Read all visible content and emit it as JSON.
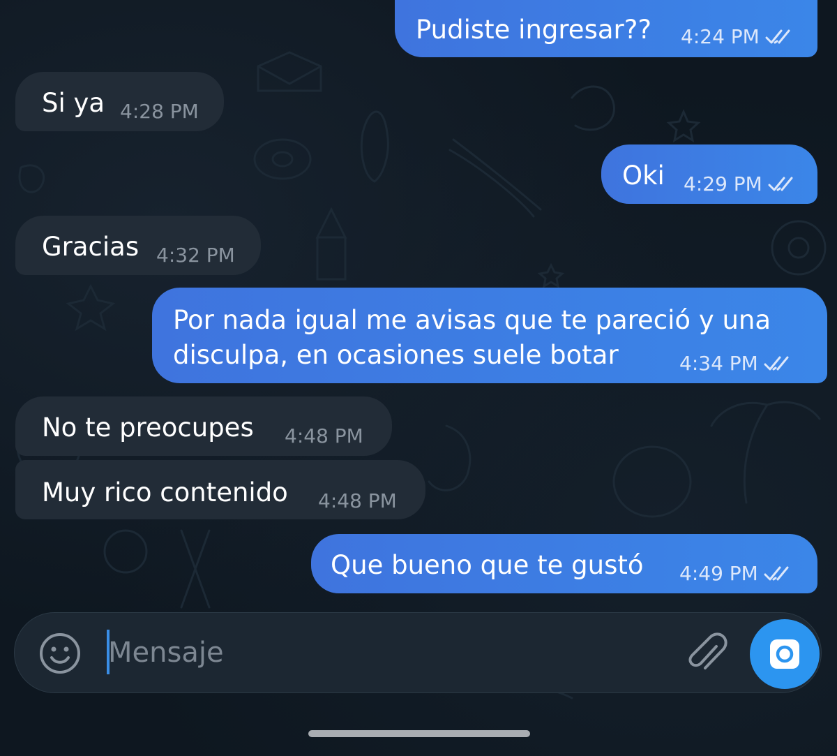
{
  "colors": {
    "background": "#0e1720",
    "incoming_bubble": "#222c37",
    "outgoing_bubble": "#3b7de4",
    "camera_button": "#2c95f0",
    "caret": "#3a8ee6"
  },
  "messages": [
    {
      "direction": "outgoing",
      "text": "Pudiste ingresar??",
      "time": "4:24 PM",
      "status_icon": "double-check-icon"
    },
    {
      "direction": "incoming",
      "text": "Si ya",
      "time": "4:28 PM"
    },
    {
      "direction": "outgoing",
      "text": "Oki",
      "time": "4:29 PM",
      "status_icon": "double-check-icon"
    },
    {
      "direction": "incoming",
      "text": "Gracias",
      "time": "4:32 PM"
    },
    {
      "direction": "outgoing",
      "lines": [
        "Por nada igual me avisas que te pareció y una",
        "disculpa, en ocasiones suele botar"
      ],
      "time": "4:34 PM",
      "status_icon": "double-check-icon"
    },
    {
      "direction": "incoming",
      "text": "No te preocupes",
      "time": "4:48 PM"
    },
    {
      "direction": "incoming",
      "text": "Muy rico contenido",
      "time": "4:48 PM"
    },
    {
      "direction": "outgoing",
      "text": "Que bueno que te gustó",
      "time": "4:49 PM",
      "status_icon": "double-check-icon"
    }
  ],
  "composer": {
    "placeholder": "Mensaje",
    "value": "",
    "emoji_icon": "emoji-icon",
    "attach_icon": "paperclip-icon",
    "camera_icon": "camera-icon"
  }
}
